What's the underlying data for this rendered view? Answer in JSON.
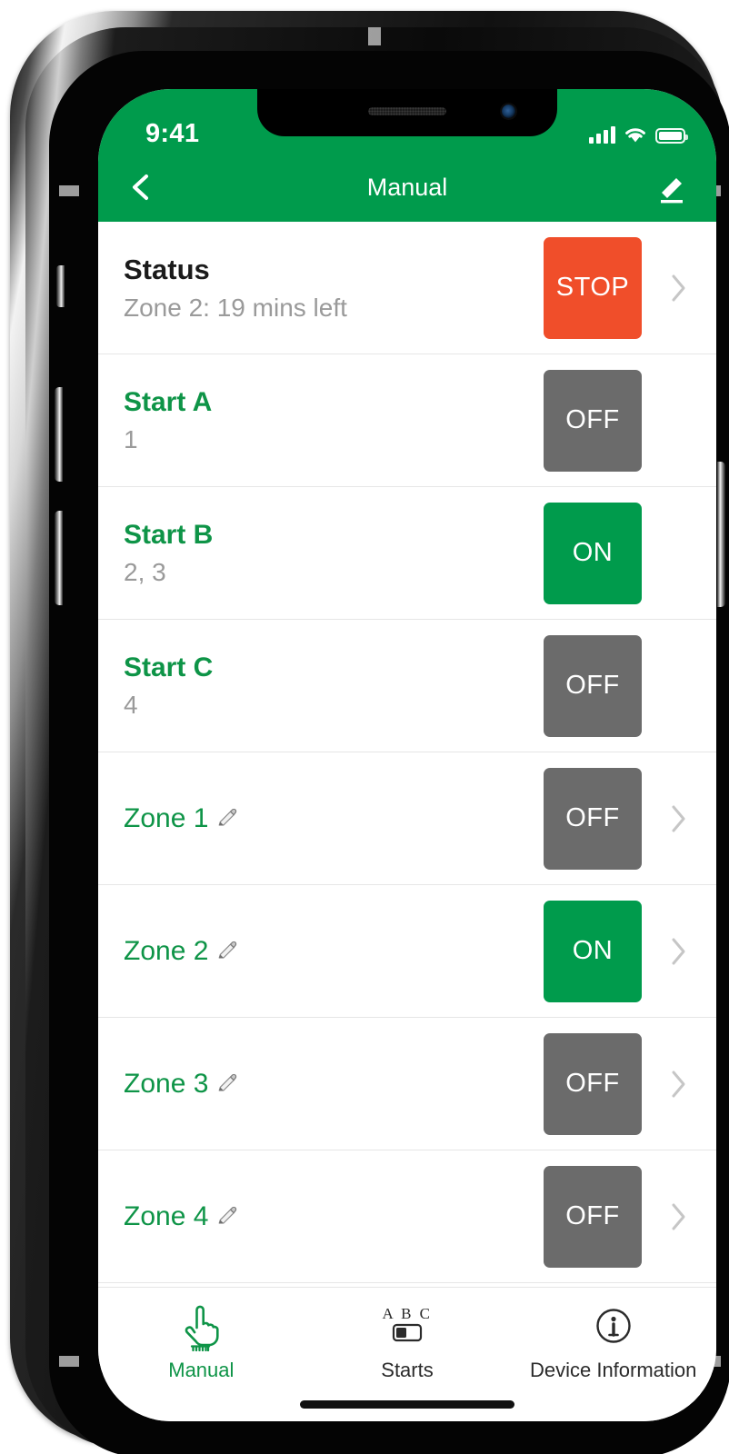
{
  "theme": {
    "brand_green": "#009B4C",
    "text_green": "#0E9447",
    "stop_red": "#F04E2A",
    "off_gray": "#6B6B6B",
    "subtext_gray": "#9A9A9A"
  },
  "status_bar": {
    "time": "9:41",
    "signal_icon": "signal-bars-icon",
    "wifi_icon": "wifi-icon",
    "battery_icon": "battery-full-icon"
  },
  "navbar": {
    "back_icon": "chevron-left-icon",
    "title": "Manual",
    "edit_icon": "pencil-edit-icon"
  },
  "list": {
    "rows": [
      {
        "name": "status",
        "title": "Status",
        "subtitle": "Zone 2:  19 mins left",
        "button_label": "STOP",
        "button_state": "stop",
        "has_chevron": true,
        "has_pencil": false
      },
      {
        "name": "start-a",
        "title": "Start A",
        "subtitle": "1",
        "button_label": "OFF",
        "button_state": "off",
        "has_chevron": false,
        "has_pencil": false
      },
      {
        "name": "start-b",
        "title": "Start B",
        "subtitle": "2, 3",
        "button_label": "ON",
        "button_state": "on",
        "has_chevron": false,
        "has_pencil": false
      },
      {
        "name": "start-c",
        "title": "Start C",
        "subtitle": "4",
        "button_label": "OFF",
        "button_state": "off",
        "has_chevron": false,
        "has_pencil": false
      },
      {
        "name": "zone-1",
        "title": "Zone 1",
        "subtitle": "",
        "button_label": "OFF",
        "button_state": "off",
        "has_chevron": true,
        "has_pencil": true
      },
      {
        "name": "zone-2",
        "title": "Zone 2",
        "subtitle": "",
        "button_label": "ON",
        "button_state": "on",
        "has_chevron": true,
        "has_pencil": true
      },
      {
        "name": "zone-3",
        "title": "Zone 3",
        "subtitle": "",
        "button_label": "OFF",
        "button_state": "off",
        "has_chevron": true,
        "has_pencil": true
      },
      {
        "name": "zone-4",
        "title": "Zone 4",
        "subtitle": "",
        "button_label": "OFF",
        "button_state": "off",
        "has_chevron": true,
        "has_pencil": true
      }
    ]
  },
  "tabbar": {
    "tabs": [
      {
        "name": "manual",
        "label": "Manual",
        "icon": "pointing-hand-icon",
        "active": true
      },
      {
        "name": "starts",
        "label": "Starts",
        "icon": "abc-switch-icon",
        "active": false
      },
      {
        "name": "device",
        "label": "Device Information",
        "icon": "info-circle-icon",
        "active": false
      }
    ]
  }
}
